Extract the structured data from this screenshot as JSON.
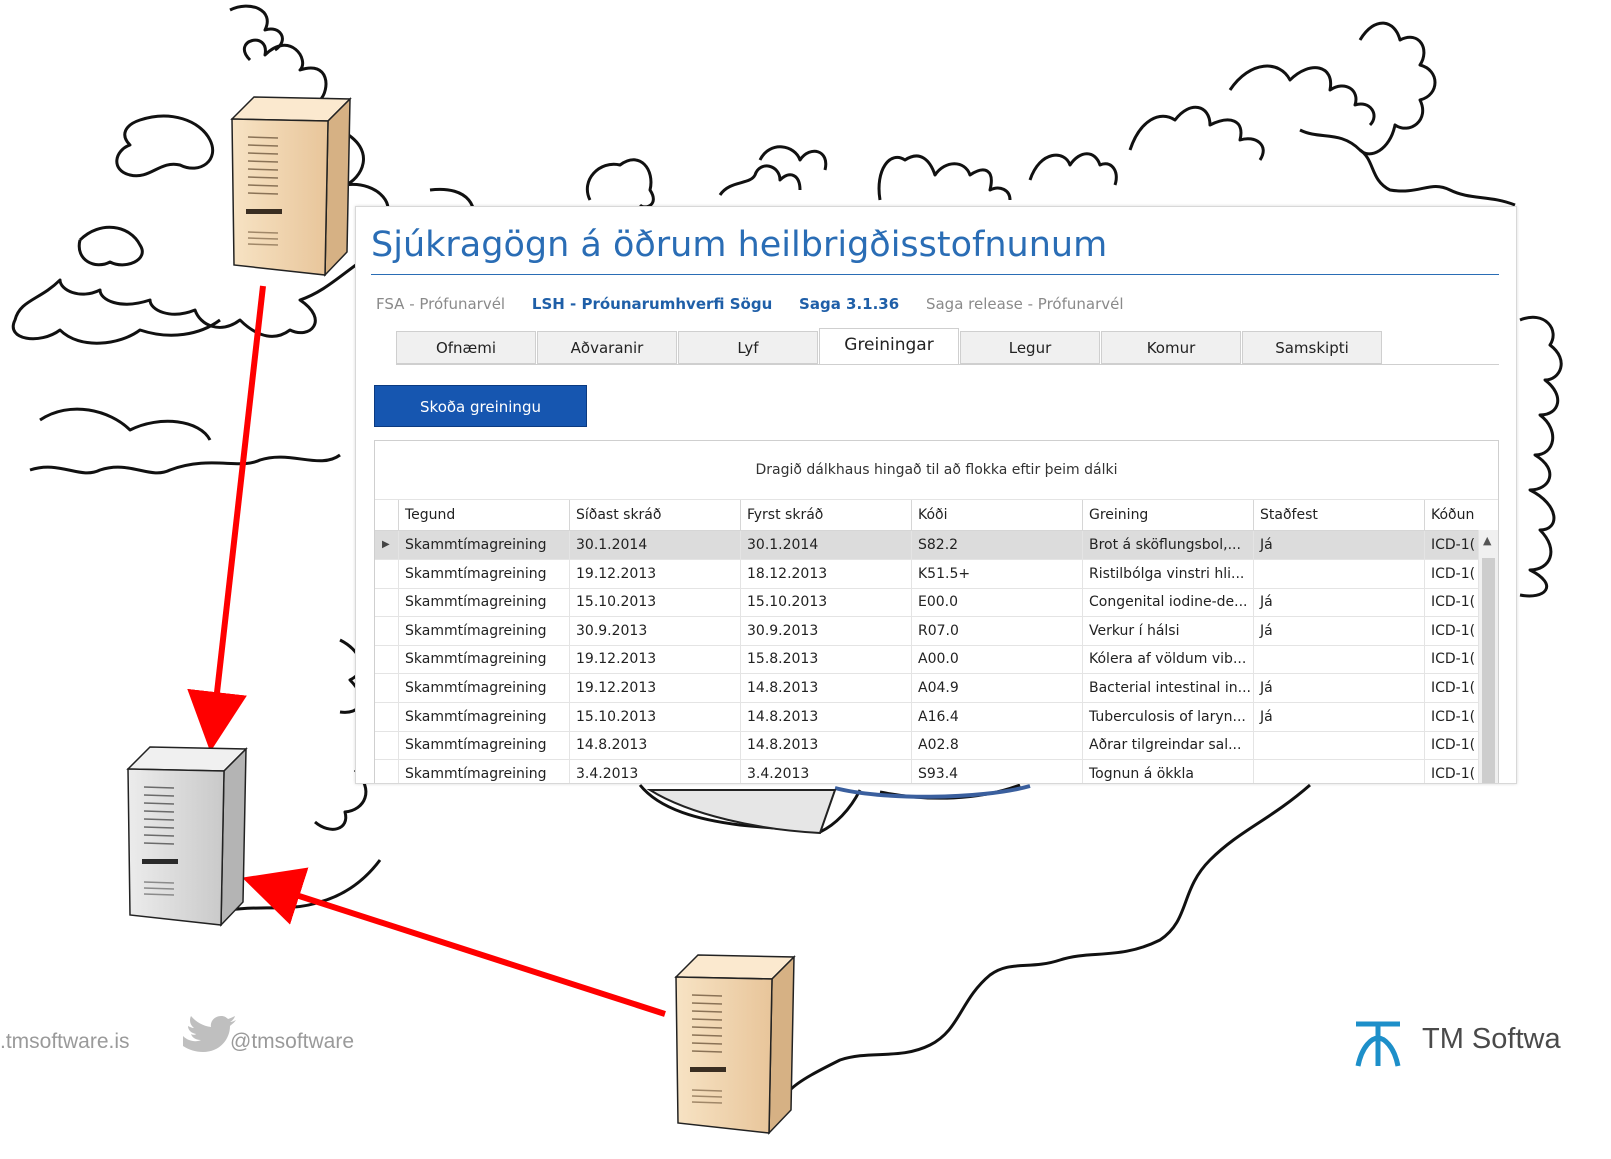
{
  "window": {
    "title": "Sjúkragögn á öðrum heilbrigðisstofnunum",
    "sources": [
      {
        "label": "FSA - Prófunarvél",
        "state": "dim"
      },
      {
        "label": "LSH - Próunarumhverfi Sögu",
        "state": "active"
      },
      {
        "label": "Saga 3.1.36",
        "state": "active"
      },
      {
        "label": "Saga release - Prófunarvél",
        "state": "dim"
      }
    ],
    "tabs": [
      "Ofnæmi",
      "Aðvaranir",
      "Lyf",
      "Greiningar",
      "Legur",
      "Komur",
      "Samskipti"
    ],
    "selected_tab": "Greiningar",
    "view_button": "Skoða greiningu",
    "group_hint": "Dragið dálkhaus hingað til að flokka eftir þeim dálki",
    "columns": [
      "Tegund",
      "Síðast skráð",
      "Fyrst skráð",
      "Kóði",
      "Greining",
      "Staðfest",
      "Kóðun"
    ],
    "rows": [
      [
        "Skammtímagreining",
        "30.1.2014",
        "30.1.2014",
        "S82.2",
        "Brot á sköflungsbol,...",
        "Já",
        "ICD-1("
      ],
      [
        "Skammtímagreining",
        "19.12.2013",
        "18.12.2013",
        "K51.5+",
        "Ristilbólga vinstri hli...",
        "",
        "ICD-1("
      ],
      [
        "Skammtímagreining",
        "15.10.2013",
        "15.10.2013",
        "E00.0",
        "Congenital iodine-de...",
        "Já",
        "ICD-1("
      ],
      [
        "Skammtímagreining",
        "30.9.2013",
        "30.9.2013",
        "R07.0",
        "Verkur í hálsi",
        "Já",
        "ICD-1("
      ],
      [
        "Skammtímagreining",
        "19.12.2013",
        "15.8.2013",
        "A00.0",
        "Kólera af völdum vib...",
        "",
        "ICD-1("
      ],
      [
        "Skammtímagreining",
        "19.12.2013",
        "14.8.2013",
        "A04.9",
        "Bacterial intestinal in...",
        "Já",
        "ICD-1("
      ],
      [
        "Skammtímagreining",
        "15.10.2013",
        "14.8.2013",
        "A16.4",
        "Tuberculosis of laryn...",
        "Já",
        "ICD-1("
      ],
      [
        "Skammtímagreining",
        "14.8.2013",
        "14.8.2013",
        "A02.8",
        "Aðrar tilgreindar sal...",
        "",
        "ICD-1("
      ],
      [
        "Skammtímagreining",
        "3.4.2013",
        "3.4.2013",
        "S93.4",
        "Tognun á ökkla",
        "",
        "ICD-1("
      ]
    ],
    "selected_row": 0
  },
  "footer": {
    "website": ".tmsoftware.is",
    "twitter": "@tmsoftware",
    "brand": "TM Softwa"
  },
  "colors": {
    "accent": "#2a6db5",
    "button": "#1656b0",
    "arrow": "#ff0000",
    "server_beige": "#f0d3ac",
    "server_gray": "#d4d4d4"
  }
}
